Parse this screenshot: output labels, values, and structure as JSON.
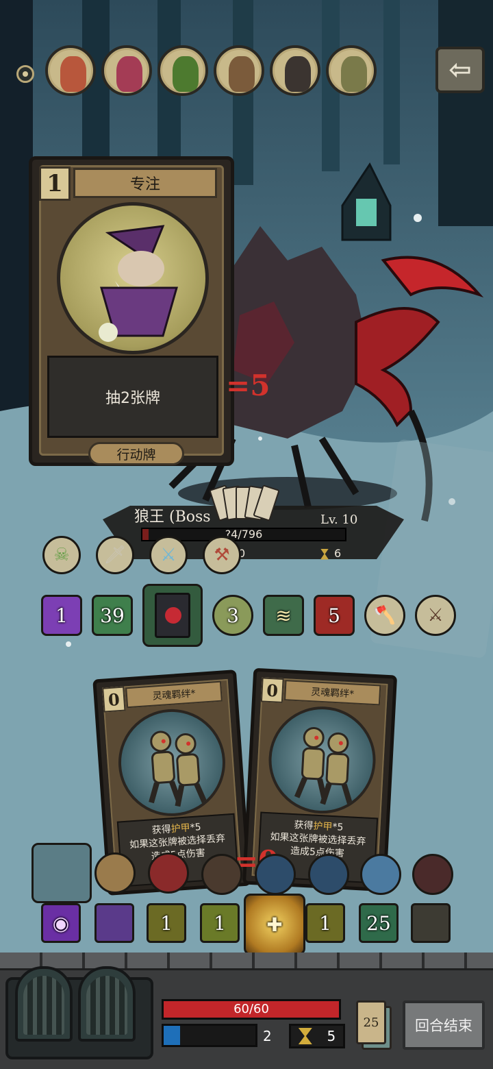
{
  "hud_top": {
    "enemy_portraits": [
      {
        "name": "portrait-ranger",
        "color": "#b8573c"
      },
      {
        "name": "portrait-demon",
        "color": "#a43c55"
      },
      {
        "name": "portrait-goblin",
        "color": "#4d7a2f"
      },
      {
        "name": "portrait-brawler",
        "color": "#7b5b3b"
      },
      {
        "name": "portrait-plague-doctor",
        "color": "#3b3430"
      },
      {
        "name": "portrait-ogre",
        "color": "#7a7a4a"
      }
    ],
    "back_icon": "arrow-left-icon",
    "back_glyph": "⇦"
  },
  "info_card": {
    "cost": "1",
    "title": "专注",
    "description": "抽2张牌",
    "type": "行动牌"
  },
  "damage_float": "=5",
  "boss": {
    "name": "狼王 (Boss",
    "level": "Lv. 10",
    "hp_text": "?4/796",
    "hp_fraction": 0.03,
    "armor": "0",
    "turns": "6"
  },
  "enemy_intents": [
    {
      "name": "zombie-icon",
      "glyph": "☠",
      "color": "#6aa04c"
    },
    {
      "name": "sword-icon",
      "glyph": "🗡",
      "color": "#c9c4b5"
    },
    {
      "name": "ice-blade-icon",
      "glyph": "⚔",
      "color": "#6fb7d6"
    },
    {
      "name": "twin-blade-icon",
      "glyph": "⚒",
      "color": "#b04a3a"
    }
  ],
  "enemy_status": [
    {
      "name": "tarot-card-icon",
      "value": "1",
      "color": "#7c3fb4"
    },
    {
      "name": "poison-icon",
      "value": "39",
      "color": "#3f7f4c"
    },
    {
      "name": "grimoire-icon",
      "value": "",
      "color": "#335b3e"
    },
    {
      "name": "map-icon",
      "value": "3",
      "color": "#4b6b3a"
    },
    {
      "name": "scroll-icon",
      "value": "",
      "color": "#3f6b4a"
    },
    {
      "name": "rage-icon",
      "value": "5",
      "color": "#9e2a25"
    },
    {
      "name": "axe-icon",
      "value": "",
      "color": "#3d3b33"
    },
    {
      "name": "crossed-blades-icon",
      "value": "",
      "color": "#3d3b33"
    }
  ],
  "hand_cards": [
    {
      "cost": "0",
      "title": "灵魂羁绊*",
      "line1_pre": "获得",
      "line1_hl": "护甲",
      "line1_post": "*5",
      "line2": "如果这张牌被选择丢弃",
      "line3": "造成5点伤害"
    },
    {
      "cost": "0",
      "title": "灵魂羁绊*",
      "line1_pre": "获得",
      "line1_hl": "护甲",
      "line1_post": "*5",
      "line2": "如果这张牌被选择丢弃",
      "line3": "造成5点伤害"
    }
  ],
  "zero_float": "=0",
  "player_buffs_top": [
    {
      "name": "bookshelf-icon",
      "color": "#5b7d86"
    },
    {
      "name": "cannon-icon",
      "color": "#9a7b4c"
    },
    {
      "name": "hooded-mage-icon",
      "color": "#8a2a2a"
    },
    {
      "name": "hood-icon",
      "color": "#4a3a2e"
    },
    {
      "name": "wolf-claw-icon",
      "color": "#2d4c6a"
    },
    {
      "name": "bat-icon",
      "color": "#2d4c6a"
    },
    {
      "name": "lightning-icon",
      "color": "#4b7aa0"
    },
    {
      "name": "vampire-icon",
      "color": "#4a2a2a"
    }
  ],
  "player_buffs_bottom": [
    {
      "name": "eye-icon",
      "value": "",
      "color": "#6a2fa4"
    },
    {
      "name": "curse-icon",
      "value": "",
      "color": "#5a3a8a"
    },
    {
      "name": "boot-icon",
      "value": "1",
      "color": "#6b6a24"
    },
    {
      "name": "boot-icon",
      "value": "1",
      "color": "#6a7a28"
    },
    {
      "name": "holy-shield-icon",
      "value": "",
      "color": "#7a4a22"
    },
    {
      "name": "boot-icon",
      "value": "1",
      "color": "#6b6a24"
    },
    {
      "name": "herb-icon",
      "value": "25",
      "color": "#2f6a4a"
    },
    {
      "name": "monster-party-icon",
      "value": "",
      "color": "#3d3b33"
    }
  ],
  "player": {
    "hp_text": "60/60",
    "hp_fraction": 1.0,
    "mana": "2",
    "mana_fraction": 0.18,
    "turns": "5",
    "deck_count": "25",
    "end_turn_label": "回合结束"
  }
}
